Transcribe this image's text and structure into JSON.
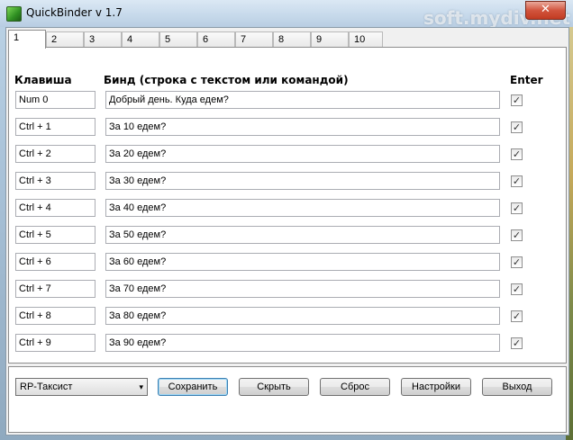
{
  "window": {
    "title": "QuickBinder v 1.7",
    "close_glyph": "✕",
    "watermark": "soft.mydiv.net"
  },
  "tabs": [
    "1",
    "2",
    "3",
    "4",
    "5",
    "6",
    "7",
    "8",
    "9",
    "10"
  ],
  "headers": {
    "key": "Клавиша",
    "bind": "Бинд (строка с текстом или командой)",
    "enter": "Enter"
  },
  "rows": [
    {
      "key": "Num 0",
      "bind": "Добрый день. Куда едем?",
      "enter": true
    },
    {
      "key": "Ctrl + 1",
      "bind": "За 10 едем?",
      "enter": true
    },
    {
      "key": "Ctrl + 2",
      "bind": "За 20 едем?",
      "enter": true
    },
    {
      "key": "Ctrl + 3",
      "bind": "За 30 едем?",
      "enter": true
    },
    {
      "key": "Ctrl + 4",
      "bind": "За 40 едем?",
      "enter": true
    },
    {
      "key": "Ctrl + 5",
      "bind": "За 50 едем?",
      "enter": true
    },
    {
      "key": "Ctrl + 6",
      "bind": "За 60 едем?",
      "enter": true
    },
    {
      "key": "Ctrl + 7",
      "bind": "За 70 едем?",
      "enter": true
    },
    {
      "key": "Ctrl + 8",
      "bind": "За 80 едем?",
      "enter": true
    },
    {
      "key": "Ctrl + 9",
      "bind": "За 90 едем?",
      "enter": true
    }
  ],
  "profile": {
    "selected": "RP-Таксист",
    "arrow": "▾"
  },
  "buttons": {
    "save": "Сохранить",
    "hide": "Скрыть",
    "reset": "Сброс",
    "settings": "Настройки",
    "exit": "Выход"
  },
  "check_glyph": "✓"
}
